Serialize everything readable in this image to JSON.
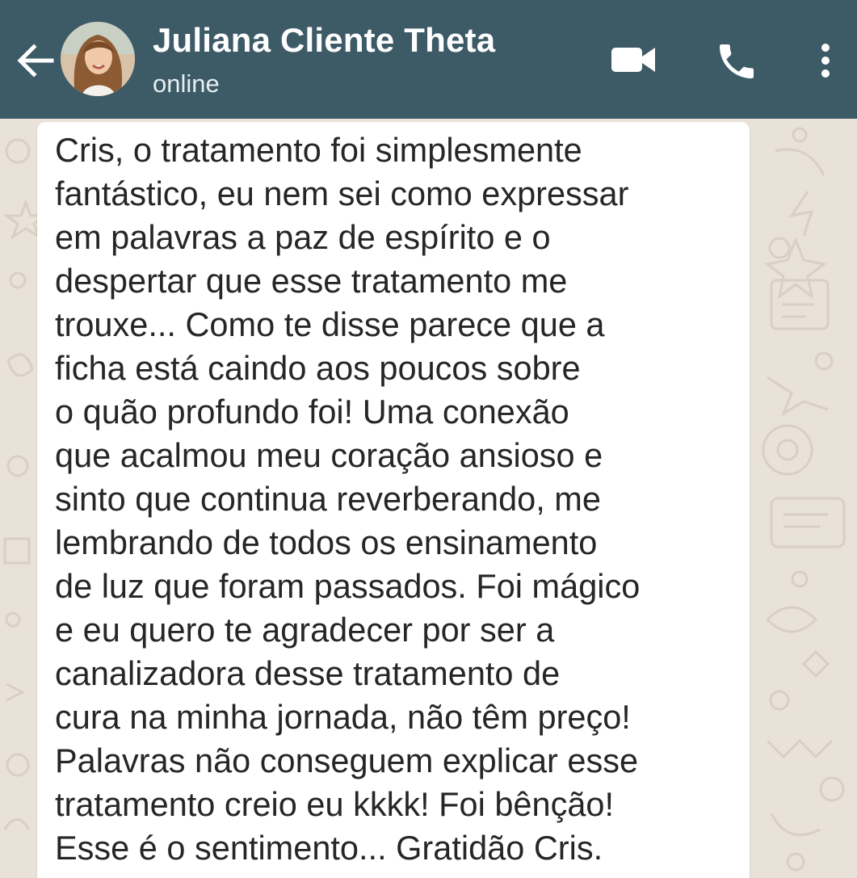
{
  "header": {
    "contact_name": "Juliana Cliente Theta",
    "status": "online",
    "background_color": "#3d5a67",
    "icons": {
      "back": "arrow-left-icon",
      "video": "video-camera-icon",
      "call": "phone-icon",
      "menu": "more-vertical-icon"
    }
  },
  "chat": {
    "wallpaper_color": "#e9e2d8",
    "messages": [
      {
        "direction": "incoming",
        "text": "Cris, o tratamento foi simplesmente\nfantástico, eu nem sei como expressar\nem palavras a paz de espírito e o\ndespertar que esse tratamento me\ntrouxe... Como te disse parece que a\nficha está caindo aos poucos sobre\no quão profundo foi! Uma conexão\nque acalmou meu coração ansioso e\nsinto que continua reverberando, me\nlembrando de todos os ensinamento\nde luz que foram passados. Foi mágico\ne eu quero te agradecer por ser a\ncanalizadora desse tratamento de\ncura na minha jornada, não têm preço!\nPalavras não conseguem explicar esse\ntratamento creio eu kkkk! Foi bênção!\nEsse é o sentimento... Gratidão Cris."
      }
    ]
  }
}
